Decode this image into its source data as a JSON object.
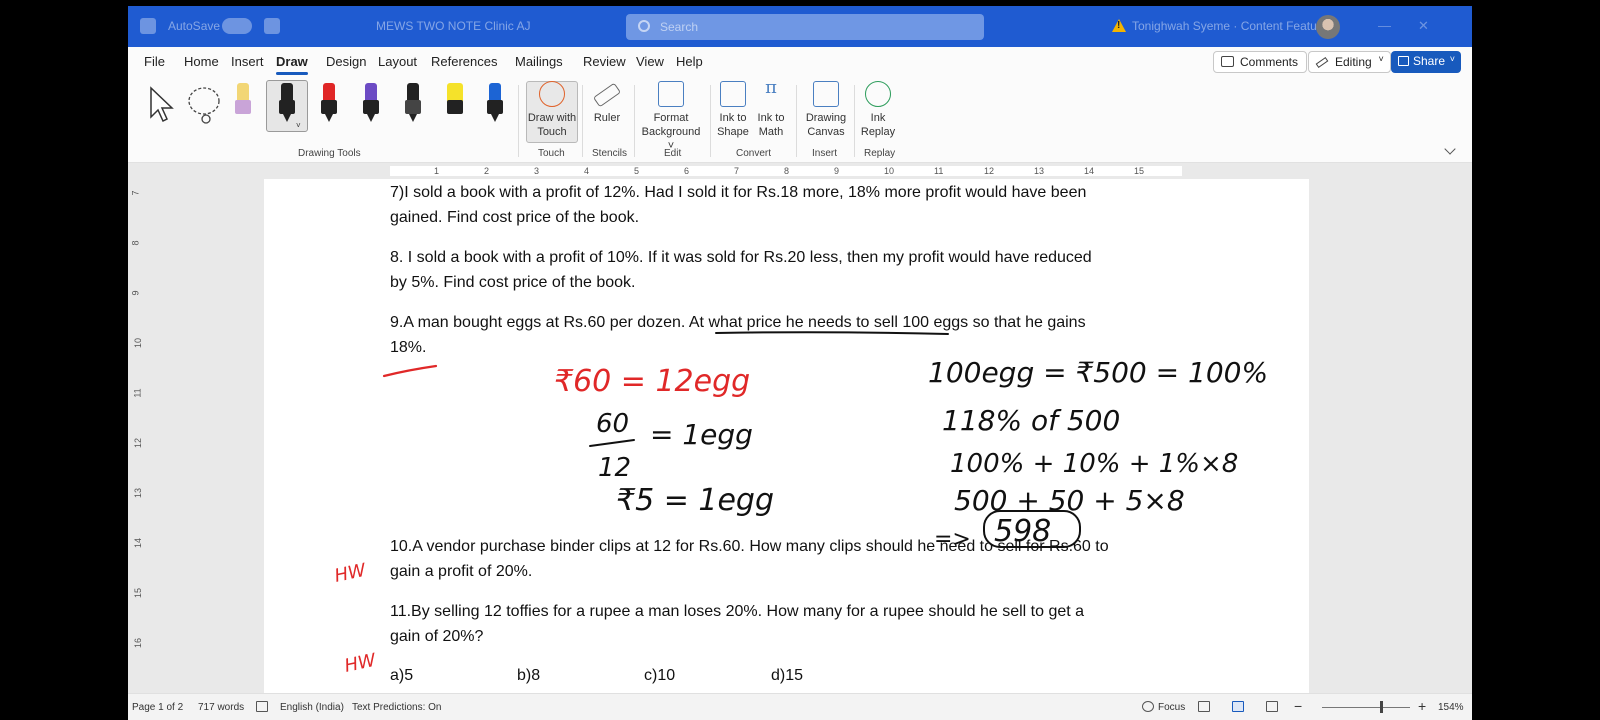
{
  "titlebar": {
    "autosave_label": "AutoSave",
    "doc_title": "MEWS TWO NOTE Clinic AJ",
    "search_placeholder": "Search",
    "user_name": "Tonighwah Syeme · Content Features"
  },
  "tabs": [
    "File",
    "Home",
    "Insert",
    "Draw",
    "Design",
    "Layout",
    "References",
    "Mailings",
    "Review",
    "View",
    "Help"
  ],
  "active_tab": "Draw",
  "tab_actions": {
    "comments": "Comments",
    "editing": "Editing",
    "share": "Share"
  },
  "ribbon": {
    "groups": {
      "drawing_tools": "Drawing Tools",
      "touch": "Touch",
      "stencils": "Stencils",
      "edit": "Edit",
      "convert": "Convert",
      "insert": "Insert",
      "replay": "Replay"
    },
    "buttons": {
      "draw_with_touch": "Draw with Touch",
      "ruler": "Ruler",
      "format_background": "Format Background ˅",
      "ink_to_shape": "Ink to Shape",
      "ink_to_math": "Ink to Math",
      "drawing_canvas": "Drawing Canvas",
      "ink_replay": "Ink Replay"
    },
    "pen_colors": [
      "#f2d675",
      "#222222",
      "#e02626",
      "#6c4bc4",
      "#222222",
      "#f5e22a",
      "#1c64d4"
    ]
  },
  "ruler_numbers": [
    "1",
    "2",
    "3",
    "4",
    "5",
    "6",
    "7",
    "8",
    "9",
    "10",
    "11",
    "12",
    "13",
    "14",
    "15"
  ],
  "vruler_numbers": [
    "7",
    "8",
    "9",
    "10",
    "11",
    "12",
    "13",
    "14",
    "15",
    "16"
  ],
  "document": {
    "q7_line1": "7)I sold a book with a profit of 12%. Had I sold it for Rs.18 more, 18% more profit would have been",
    "q7_line2": "gained. Find cost price of the book.",
    "q8_line1": "8. I sold a book with a profit of 10%. If it was sold for Rs.20 less, then my profit would have reduced",
    "q8_line2": "by 5%. Find cost price of the book.",
    "q9_line1_a": "9.A man bought eggs at Rs.60 per dozen. ",
    "q9_line1_b": "At what price he needs to sell ",
    "q9_line1_c": "100 eggs so that he gains",
    "q9_line2": "18%.",
    "q10_line1": "10.A vendor purchase binder clips at 12 for Rs.60. How many clips should he need to sell for Rs.60 to",
    "q10_line2": "gain a profit of 20%.",
    "q11_line1": "11.By selling 12 toffies for a rupee a man loses 20%. How many for a rupee should he sell to get a",
    "q11_line2": "gain of 20%?",
    "options": [
      "a)5",
      "b)8",
      "c)10",
      "d)15"
    ]
  },
  "ink": {
    "left_line1": "₹60 = 12egg",
    "left_frac_num": "60",
    "left_frac_den": "12",
    "left_line2_rhs": "= 1egg",
    "left_line3": "₹5 = 1egg",
    "right_line1": "100egg = ₹500 = 100%",
    "right_line2": "118% of 500",
    "right_line3": "100% + 10% + 1%×8",
    "right_line4": "500 + 50 + 5×8",
    "right_line5_arrow": "=>",
    "right_answer": "598",
    "hw_label_1": "HW",
    "hw_label_2": "HW"
  },
  "status": {
    "page": "Page 1 of 2",
    "words": "717 words",
    "language": "English (India)",
    "text_predictions": "Text Predictions: On",
    "focus": "Focus",
    "zoom": "154%"
  }
}
